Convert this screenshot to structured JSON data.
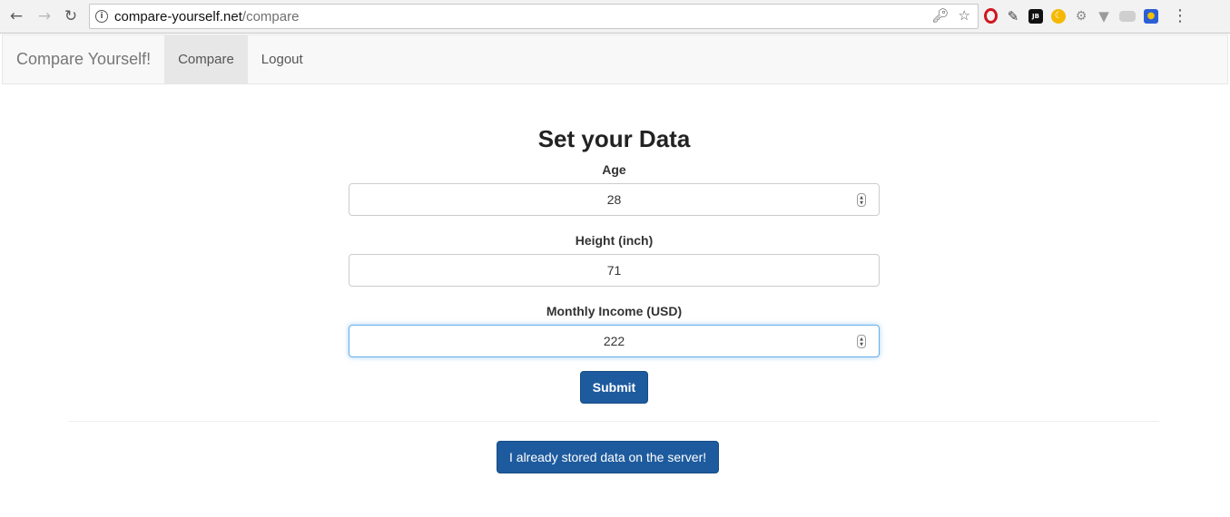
{
  "browser": {
    "url_host": "compare-yourself.net",
    "url_path": "/compare",
    "extensions": [
      "key-icon",
      "star-icon",
      "opera-icon",
      "pen-icon",
      "jb-icon",
      "moon-icon",
      "gear-icon",
      "v-icon",
      "camera-icon",
      "blue-ext-icon",
      "menu-icon"
    ],
    "ext_jb_text": "JB"
  },
  "navbar": {
    "brand": "Compare Yourself!",
    "items": [
      {
        "label": "Compare",
        "active": true
      },
      {
        "label": "Logout",
        "active": false
      }
    ]
  },
  "form": {
    "title": "Set your Data",
    "fields": [
      {
        "label": "Age",
        "value": "28",
        "spinner": true,
        "focused": false
      },
      {
        "label": "Height (inch)",
        "value": "71",
        "spinner": false,
        "focused": false
      },
      {
        "label": "Monthly Income (USD)",
        "value": "222",
        "spinner": true,
        "focused": true
      }
    ],
    "submit_label": "Submit"
  },
  "stored_button_label": "I already stored data on the server!",
  "colors": {
    "primary_button": "#1e5b9e",
    "focus_border": "#66afe9"
  }
}
